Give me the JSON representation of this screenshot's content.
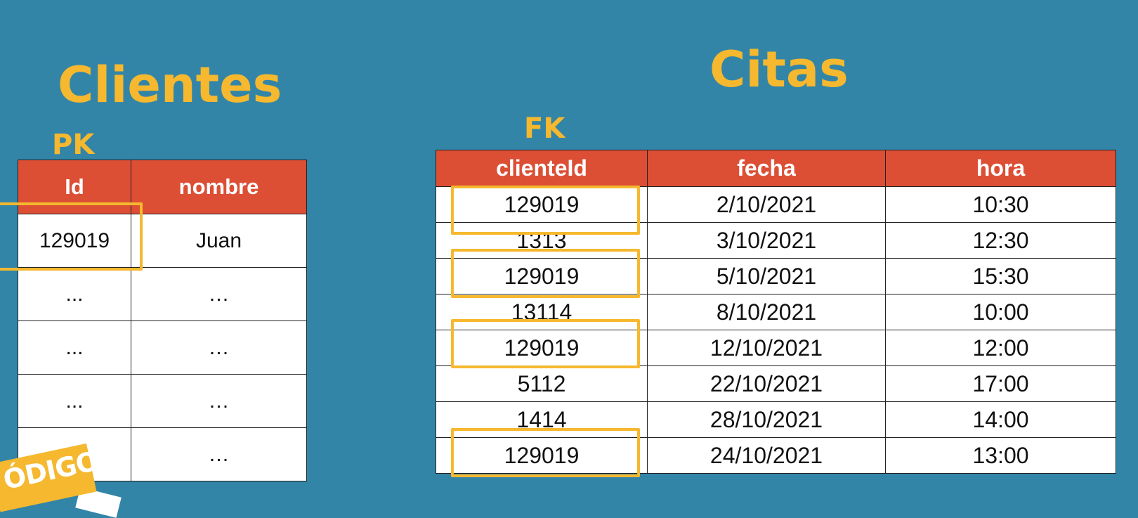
{
  "clientes": {
    "title": "Clientes",
    "key_label": "PK",
    "headers": [
      "Id",
      "nombre"
    ],
    "rows": [
      [
        "129019",
        "Juan"
      ],
      [
        "...",
        "…"
      ],
      [
        "...",
        "…"
      ],
      [
        "...",
        "…"
      ],
      [
        "...",
        "…"
      ]
    ]
  },
  "citas": {
    "title": "Citas",
    "key_label": "FK",
    "headers": [
      "clienteId",
      "fecha",
      "hora"
    ],
    "rows": [
      [
        "129019",
        "2/10/2021",
        "10:30"
      ],
      [
        "1313",
        "3/10/2021",
        "12:30"
      ],
      [
        "129019",
        "5/10/2021",
        "15:30"
      ],
      [
        "13114",
        "8/10/2021",
        "10:00"
      ],
      [
        "129019",
        "12/10/2021",
        "12:00"
      ],
      [
        "5112",
        "22/10/2021",
        "17:00"
      ],
      [
        "1414",
        "28/10/2021",
        "14:00"
      ],
      [
        "129019",
        "24/10/2021",
        "13:00"
      ]
    ]
  },
  "badge": {
    "text": "ÓDIGO"
  },
  "colors": {
    "background": "#3385A7",
    "accent": "#F5B82E",
    "header": "#DC4F35"
  }
}
